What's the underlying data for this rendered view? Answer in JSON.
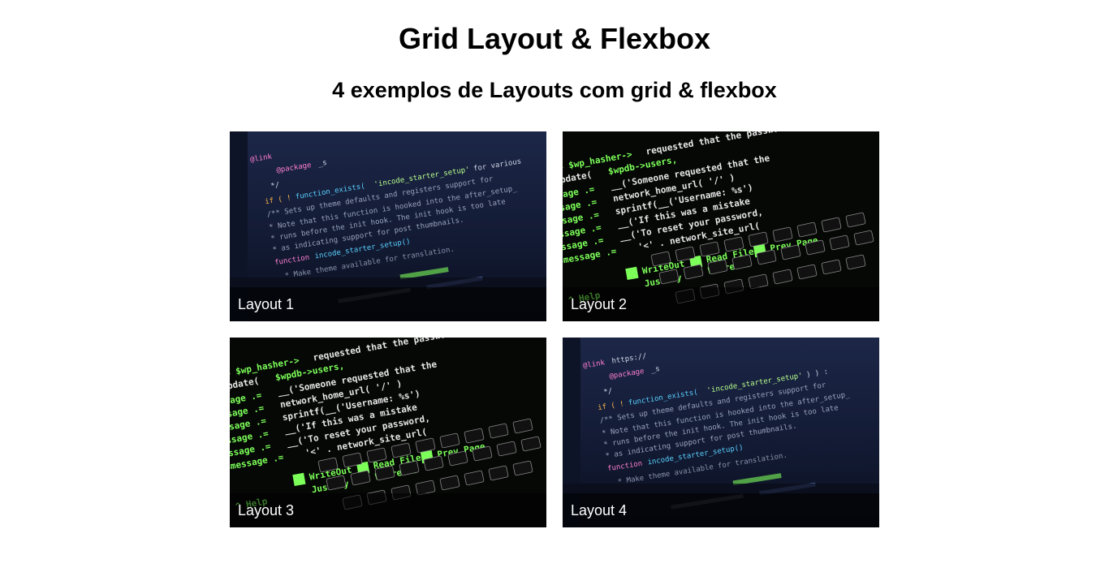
{
  "header": {
    "title": "Grid Layout & Flexbox",
    "subtitle": "4 exemplos de Layouts com grid & flexbox"
  },
  "cards": [
    {
      "label": "Layout 1",
      "image": "code-editor-photo",
      "variant": "editor"
    },
    {
      "label": "Layout 2",
      "image": "terminal-keyboard-photo",
      "variant": "keyboard"
    },
    {
      "label": "Layout 3",
      "image": "terminal-keyboard-photo",
      "variant": "keyboard"
    },
    {
      "label": "Layout 4",
      "image": "code-editor-photo",
      "variant": "editor"
    }
  ],
  "colors": {
    "editor_bg": "#141c33",
    "keyboard_bg": "#050805",
    "code_green": "#7dff5a",
    "code_white": "#e6e6e6",
    "code_pink": "#ff7fd0",
    "code_cyan": "#5ad0ff",
    "caption_overlay": "#000000"
  }
}
